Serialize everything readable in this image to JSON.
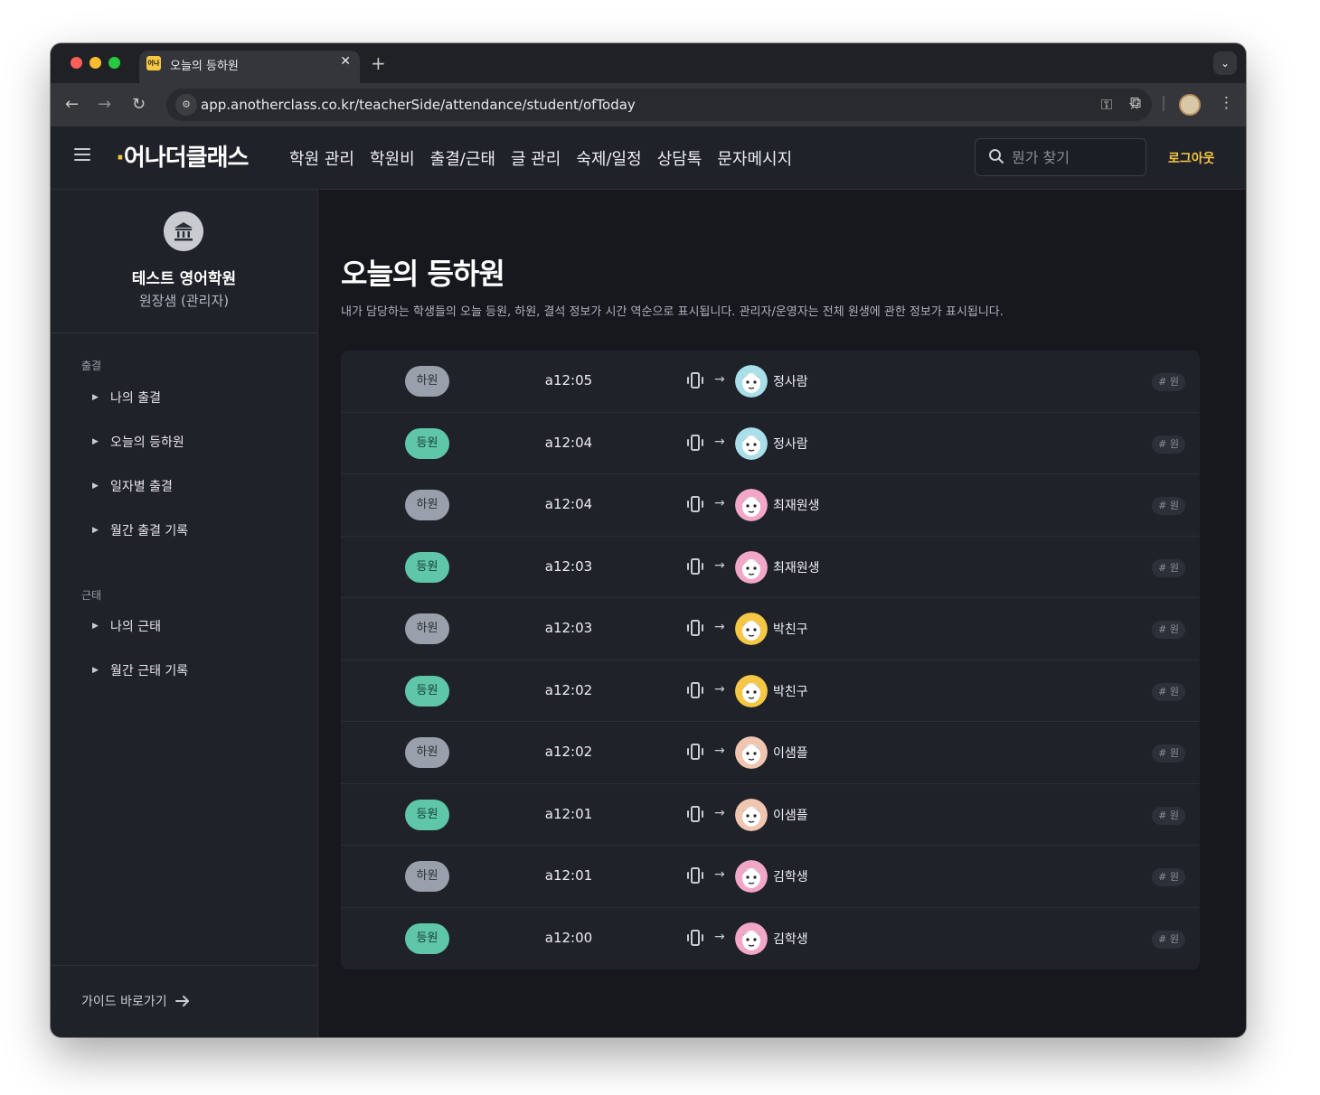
{
  "browser": {
    "tab_title": "오늘의 등하원",
    "tab_favicon_text": "어나",
    "new_tab": "+",
    "url": "app.anotherclass.co.kr/teacherSide/attendance/student/ofToday"
  },
  "header": {
    "logo": "어나더클래스",
    "nav": [
      "학원 관리",
      "학원비",
      "출결/근태",
      "글 관리",
      "숙제/일정",
      "상담톡",
      "문자메시지"
    ],
    "search_placeholder": "뭔가 찾기",
    "logout": "로그아웃"
  },
  "sidebar": {
    "org_name": "테스트 영어학원",
    "org_role": "원장샘 (관리자)",
    "section_attendance": "출결",
    "attendance_items": [
      "나의 출결",
      "오늘의 등하원",
      "일자별 출결",
      "월간 출결 기록"
    ],
    "section_work": "근태",
    "work_items": [
      "나의 근태",
      "월간 근태 기록"
    ],
    "guide": "가이드 바로가기"
  },
  "main": {
    "title": "오늘의 등하원",
    "description": "내가 담당하는 학생들의 오늘 등원, 하원, 결석 정보가 시간 역순으로 표시됩니다. 관리자/운영자는 전체 원생에 관한 정보가 표시됩니다.",
    "rows": [
      {
        "status": "하원",
        "type": "out",
        "time": "a12:05",
        "name": "정사람",
        "tag": "# 원",
        "avatar_color": "#a8dfe8"
      },
      {
        "status": "등원",
        "type": "in",
        "time": "a12:04",
        "name": "정사람",
        "tag": "# 원",
        "avatar_color": "#a8dfe8"
      },
      {
        "status": "하원",
        "type": "out",
        "time": "a12:04",
        "name": "최재원생",
        "tag": "# 원",
        "avatar_color": "#f2a7c8"
      },
      {
        "status": "등원",
        "type": "in",
        "time": "a12:03",
        "name": "최재원생",
        "tag": "# 원",
        "avatar_color": "#f2a7c8"
      },
      {
        "status": "하원",
        "type": "out",
        "time": "a12:03",
        "name": "박친구",
        "tag": "# 원",
        "avatar_color": "#f6c744"
      },
      {
        "status": "등원",
        "type": "in",
        "time": "a12:02",
        "name": "박친구",
        "tag": "# 원",
        "avatar_color": "#f6c744"
      },
      {
        "status": "하원",
        "type": "out",
        "time": "a12:02",
        "name": "이샘플",
        "tag": "# 원",
        "avatar_color": "#f0c6b0"
      },
      {
        "status": "등원",
        "type": "in",
        "time": "a12:01",
        "name": "이샘플",
        "tag": "# 원",
        "avatar_color": "#f0c6b0"
      },
      {
        "status": "하원",
        "type": "out",
        "time": "a12:01",
        "name": "김학생",
        "tag": "# 원",
        "avatar_color": "#f2a7c8"
      },
      {
        "status": "등원",
        "type": "in",
        "time": "a12:00",
        "name": "김학생",
        "tag": "# 원",
        "avatar_color": "#f2a7c8"
      }
    ]
  },
  "colors": {
    "accent": "#f6c744",
    "arrive": "#5fc6a8",
    "leave": "#9aa0ab"
  }
}
